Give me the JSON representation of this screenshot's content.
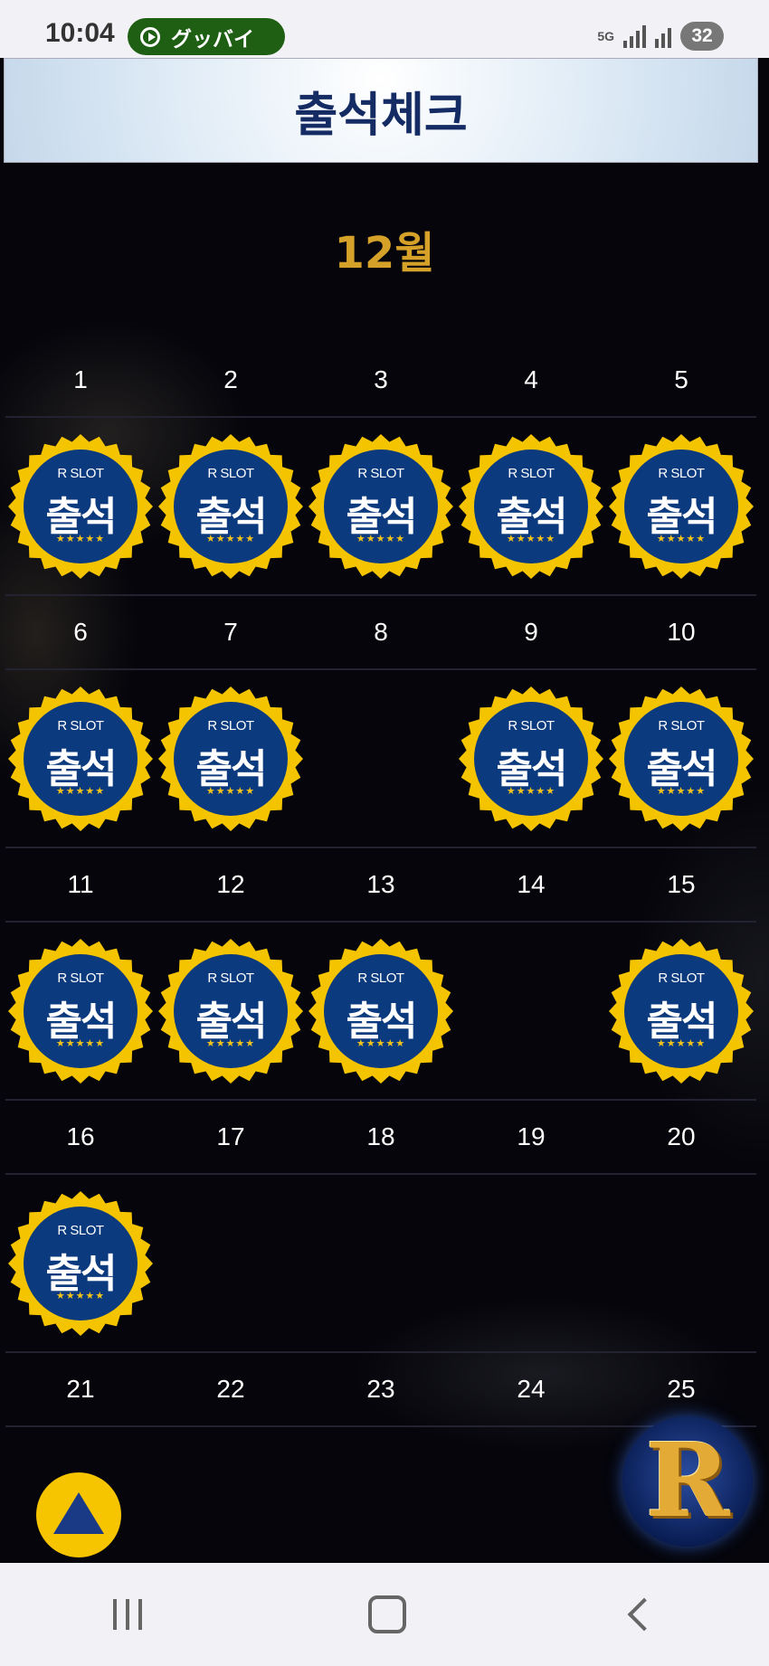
{
  "status_bar": {
    "time": "10:04",
    "notification_text": "グッバイ",
    "network": "5G",
    "battery": "32"
  },
  "header": {
    "title": "출석체크"
  },
  "calendar": {
    "month": "12월",
    "weeks": [
      {
        "days": [
          {
            "num": "1",
            "checked": true
          },
          {
            "num": "2",
            "checked": true
          },
          {
            "num": "3",
            "checked": true
          },
          {
            "num": "4",
            "checked": true
          },
          {
            "num": "5",
            "checked": true
          }
        ]
      },
      {
        "days": [
          {
            "num": "6",
            "checked": true
          },
          {
            "num": "7",
            "checked": true
          },
          {
            "num": "8",
            "checked": false
          },
          {
            "num": "9",
            "checked": true
          },
          {
            "num": "10",
            "checked": true
          }
        ]
      },
      {
        "days": [
          {
            "num": "11",
            "checked": true
          },
          {
            "num": "12",
            "checked": true
          },
          {
            "num": "13",
            "checked": true
          },
          {
            "num": "14",
            "checked": false
          },
          {
            "num": "15",
            "checked": true
          }
        ]
      },
      {
        "days": [
          {
            "num": "16",
            "checked": true
          },
          {
            "num": "17",
            "checked": false
          },
          {
            "num": "18",
            "checked": false
          },
          {
            "num": "19",
            "checked": false
          },
          {
            "num": "20",
            "checked": false
          }
        ]
      },
      {
        "days": [
          {
            "num": "21",
            "checked": false
          },
          {
            "num": "22",
            "checked": false
          },
          {
            "num": "23",
            "checked": false
          },
          {
            "num": "24",
            "checked": false
          },
          {
            "num": "25",
            "checked": false
          }
        ]
      }
    ]
  },
  "stamp": {
    "brand": "R SLOT",
    "label": "출석",
    "stars": "★★★★★",
    "outer_color": "#f5c400",
    "inner_color": "#0c3a7e"
  },
  "floating": {
    "logo_letter": "R",
    "scroll_top_icon": "triangle-up-icon"
  }
}
